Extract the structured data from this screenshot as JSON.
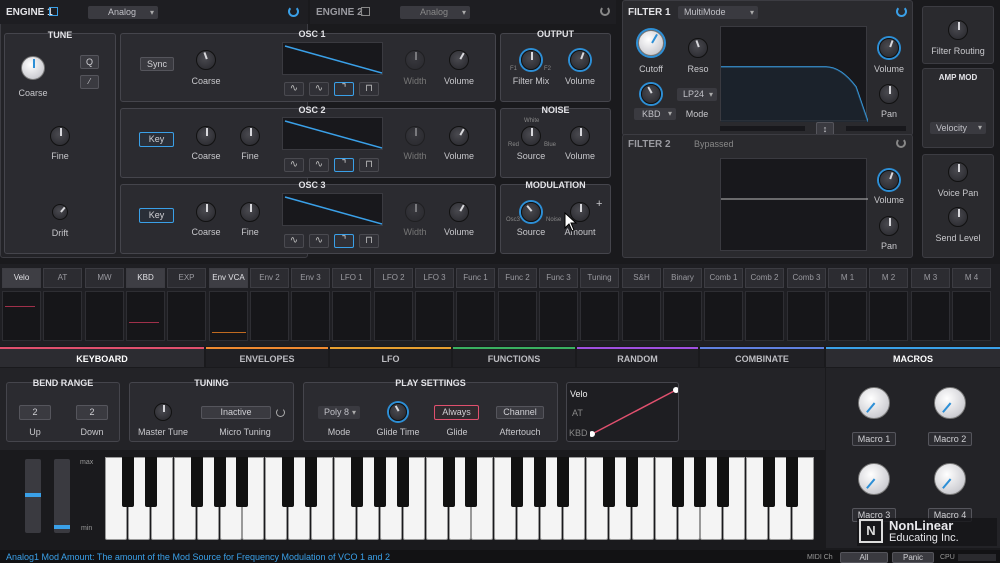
{
  "engine1": {
    "title": "ENGINE 1",
    "type": "Analog"
  },
  "engine2": {
    "title": "ENGINE 2",
    "type": "Analog"
  },
  "tune": {
    "title": "TUNE",
    "coarse": "Coarse",
    "q": "Q",
    "fine": "Fine",
    "drift": "Drift"
  },
  "osc1": {
    "title": "OSC 1",
    "sync": "Sync",
    "coarse": "Coarse",
    "width": "Width",
    "volume": "Volume"
  },
  "osc2": {
    "title": "OSC 2",
    "key": "Key",
    "coarse": "Coarse",
    "fine": "Fine",
    "width": "Width",
    "volume": "Volume"
  },
  "osc3": {
    "title": "OSC 3",
    "key": "Key",
    "coarse": "Coarse",
    "fine": "Fine",
    "width": "Width",
    "volume": "Volume"
  },
  "output": {
    "title": "OUTPUT",
    "filter_mix": "Filter Mix",
    "volume": "Volume",
    "f1": "F1",
    "f2": "F2"
  },
  "noise": {
    "title": "NOISE",
    "source": "Source",
    "volume": "Volume",
    "white": "White",
    "red": "Red",
    "blue": "Blue"
  },
  "modulation": {
    "title": "MODULATION",
    "source": "Source",
    "amount": "Amount",
    "osc3": "Osc3",
    "noise": "Noise"
  },
  "filter1": {
    "title": "FILTER 1",
    "type": "MultiMode",
    "cutoff": "Cutoff",
    "reso": "Reso",
    "kbd": "KBD",
    "mode_value": "LP24",
    "mode": "Mode",
    "volume": "Volume",
    "pan": "Pan"
  },
  "filter2": {
    "title": "FILTER 2",
    "status": "Bypassed",
    "volume": "Volume",
    "pan": "Pan"
  },
  "right_col": {
    "filter_routing": "Filter Routing",
    "amp_mod": "AMP MOD",
    "velocity": "Velocity",
    "voice_pan": "Voice Pan",
    "send_level": "Send Level"
  },
  "mod_sources": [
    "Velo",
    "AT",
    "MW",
    "KBD",
    "EXP",
    "Env VCA",
    "Env 2",
    "Env 3",
    "LFO 1",
    "LFO 2",
    "LFO 3",
    "Func 1",
    "Func 2",
    "Func 3",
    "Tuning",
    "S&H",
    "Binary",
    "Comb 1",
    "Comb 2",
    "Comb 3",
    "M 1",
    "M 2",
    "M 3",
    "M 4"
  ],
  "tabs": [
    "KEYBOARD",
    "ENVELOPES",
    "LFO",
    "FUNCTIONS",
    "RANDOM",
    "COMBINATE",
    "MACROS"
  ],
  "bend": {
    "title": "BEND RANGE",
    "up_value": "2",
    "down_value": "2",
    "up": "Up",
    "down": "Down"
  },
  "tuning": {
    "title": "TUNING",
    "master": "Master Tune",
    "micro_value": "Inactive",
    "micro": "Micro Tuning"
  },
  "play": {
    "title": "PLAY SETTINGS",
    "mode_value": "Poly 8",
    "mode": "Mode",
    "glide_time": "Glide Time",
    "glide_value": "Always",
    "glide": "Glide",
    "after_value": "Channel",
    "after": "Aftertouch"
  },
  "velo_curve": {
    "velo": "Velo",
    "at": "AT",
    "kbd": "KBD"
  },
  "wheels": {
    "max": "max",
    "min": "min"
  },
  "macros": {
    "m1": "Macro 1",
    "m2": "Macro 2",
    "m3": "Macro 3",
    "m4": "Macro 4"
  },
  "status": {
    "text": "Analog1 Mod Amount: The amount of the Mod Source for Frequency Modulation of VCO 1 and 2",
    "midi_ch": "MIDI Ch",
    "all": "All",
    "panic": "Panic",
    "cpu": "CPU"
  },
  "watermark": {
    "line1": "NonLinear",
    "line2": "Educating Inc."
  },
  "colors": {
    "accent": "#2d8fd6",
    "pink": "#e0506e"
  }
}
